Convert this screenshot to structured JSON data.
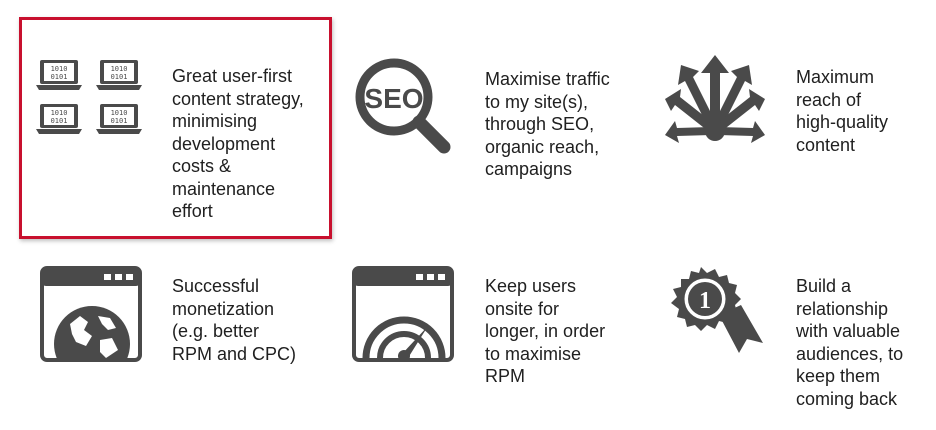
{
  "accent_color": "#c8102e",
  "icon_color": "#4a4a4a",
  "items": [
    {
      "icon": "laptops-binary-icon",
      "text": "Great user-first\ncontent strategy,\nminimising\ndevelopment\ncosts &\nmaintenance\neffort",
      "highlighted": true
    },
    {
      "icon": "seo-magnifier-icon",
      "text": "Maximise traffic\nto my site(s),\nthrough SEO,\norganic reach,\ncampaigns",
      "highlighted": false
    },
    {
      "icon": "reach-arrows-icon",
      "text": "Maximum\nreach of\nhigh-quality\ncontent",
      "highlighted": false
    },
    {
      "icon": "browser-globe-icon",
      "text": "Successful\nmonetization\n(e.g. better\nRPM and CPC)",
      "highlighted": false
    },
    {
      "icon": "browser-gauge-icon",
      "text": "Keep users\nonsite for\nlonger, in order\nto maximise\nRPM",
      "highlighted": false
    },
    {
      "icon": "award-ribbon-icon",
      "text": "Build a\nrelationship\nwith valuable\naudiences, to\nkeep them\ncoming back",
      "highlighted": false
    }
  ],
  "icon_text": {
    "seo": "SEO",
    "binary_a": "1010",
    "binary_b": "0101",
    "award_number": "1"
  }
}
